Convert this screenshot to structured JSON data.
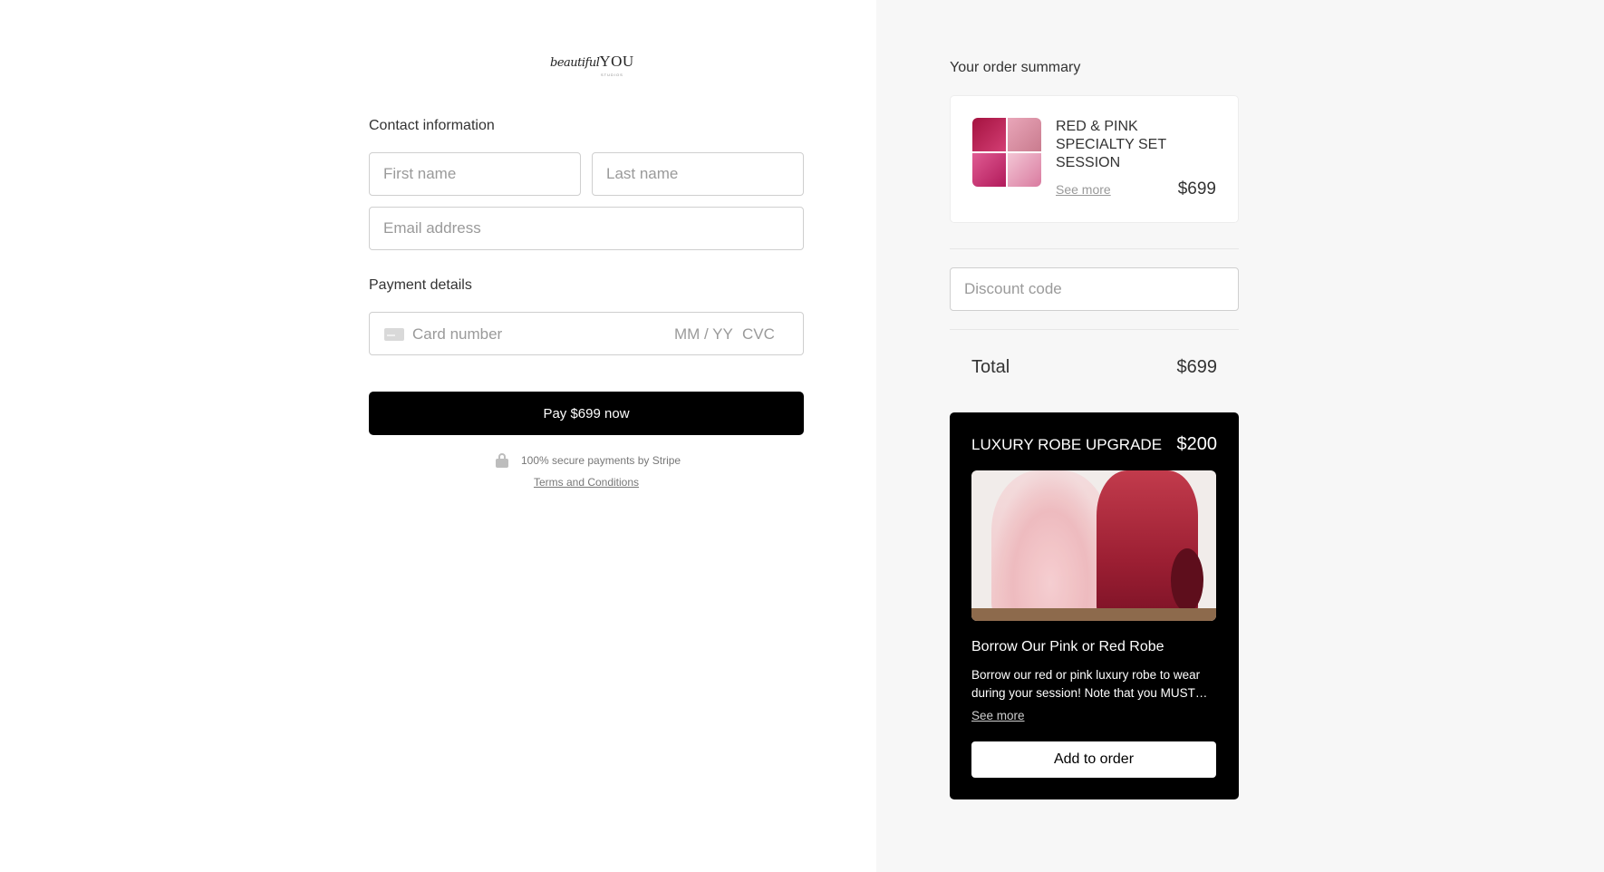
{
  "brand": {
    "logo_script": "beautiful",
    "logo_you": "YOU",
    "logo_sub": "STUDIOS"
  },
  "contact": {
    "label": "Contact information",
    "first_name_placeholder": "First name",
    "last_name_placeholder": "Last name",
    "email_placeholder": "Email address"
  },
  "payment": {
    "label": "Payment details",
    "card_number_placeholder": "Card number",
    "expiry_placeholder": "MM / YY",
    "cvc_placeholder": "CVC",
    "pay_button": "Pay $699 now",
    "secure_text": "100% secure payments by Stripe",
    "terms_link": "Terms and Conditions"
  },
  "summary": {
    "title": "Your order summary",
    "item": {
      "name": "RED & PINK SPECIALTY SET SESSION",
      "see_more": "See more",
      "price": "$699"
    },
    "discount_placeholder": "Discount code",
    "total_label": "Total",
    "total_value": "$699"
  },
  "upsell": {
    "title": "LUXURY ROBE UPGRADE",
    "price": "$200",
    "subtitle": "Borrow Our Pink or Red Robe",
    "description": "Borrow our red or pink luxury robe to wear during your session! Note that you MUST…",
    "see_more": "See more",
    "add_button": "Add to order"
  },
  "colors": {
    "right_panel_bg": "#f7f7f7",
    "button_bg": "#000000",
    "upsell_bg": "#000000"
  }
}
